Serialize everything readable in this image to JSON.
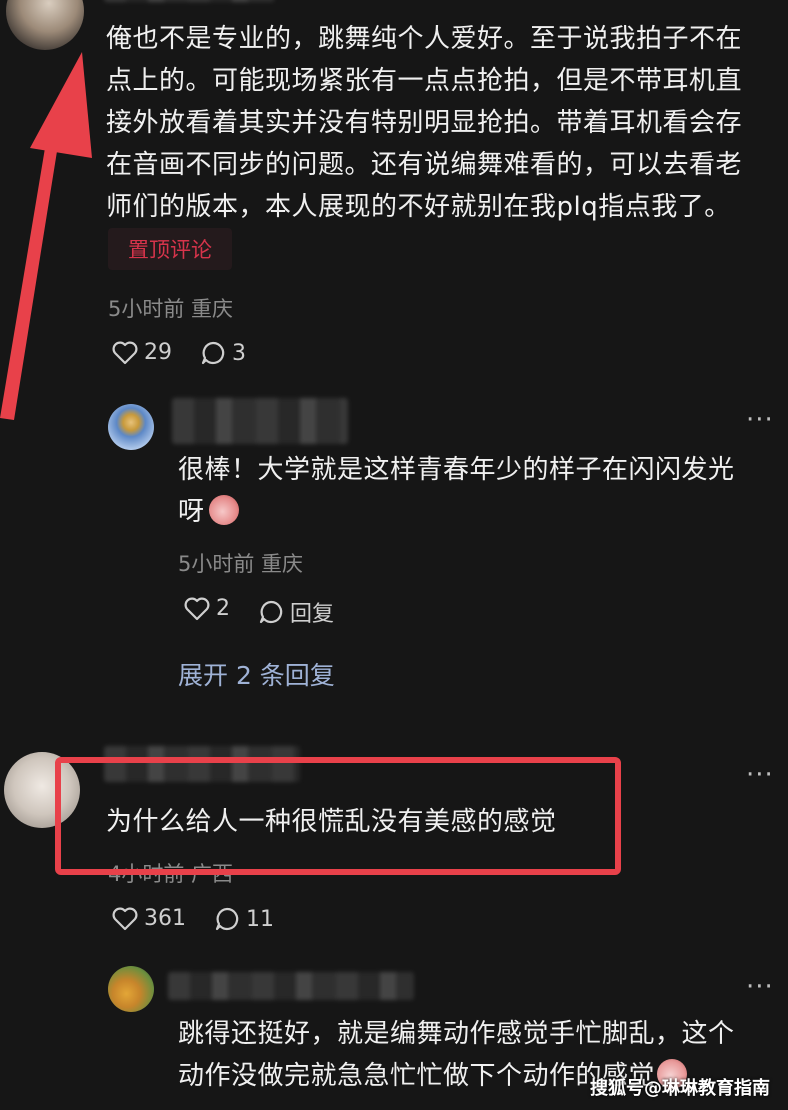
{
  "comments": [
    {
      "text": "俺也不是专业的，跳舞纯个人爱好。至于说我拍子不在点上的。可能现场紧张有一点点抢拍，但是不带耳机直接外放看着其实并没有特别明显抢拍。带着耳机看会存在音画不同步的问题。还有说编舞难看的，可以去看老师们的版本，本人展现的不好就别在我plq指点我了。",
      "lines": [
        "俺也不是专业的，跳舞纯个人爱好。至于说我拍子不在",
        "点上的。可能现场紧张有一点点抢拍，但是不带耳机直",
        "接外放看着其实并没有特别明显抢拍。带着耳机看会存",
        "在音画不同步的问题。还有说编舞难看的，可以去看老",
        "师们的版本，本人展现的不好就别在我plq指点我了。"
      ],
      "badge": "置顶评论",
      "meta": "5小时前 重庆",
      "likes": "29",
      "replies": "3"
    },
    {
      "lines": [
        "很棒！大学就是这样青春年少的样子在闪闪发光",
        "呀"
      ],
      "meta": "5小时前 重庆",
      "likes": "2",
      "reply_label": "回复",
      "expand": "展开 2 条回复",
      "more": "···"
    },
    {
      "lines": [
        "为什么给人一种很慌乱没有美感的感觉"
      ],
      "meta": "4小时前 广西",
      "likes": "361",
      "replies": "11",
      "more": "···"
    },
    {
      "lines": [
        "跳得还挺好，就是编舞动作感觉手忙脚乱，这个",
        "动作没做完就急急忙忙做下个动作的感觉"
      ],
      "more": "···"
    }
  ],
  "watermark": "搜狐号@琳琳教育指南",
  "colors": {
    "annotation_red": "#e8414a",
    "pinned_text": "#d6344b",
    "link_blue": "#9fb2d6"
  }
}
